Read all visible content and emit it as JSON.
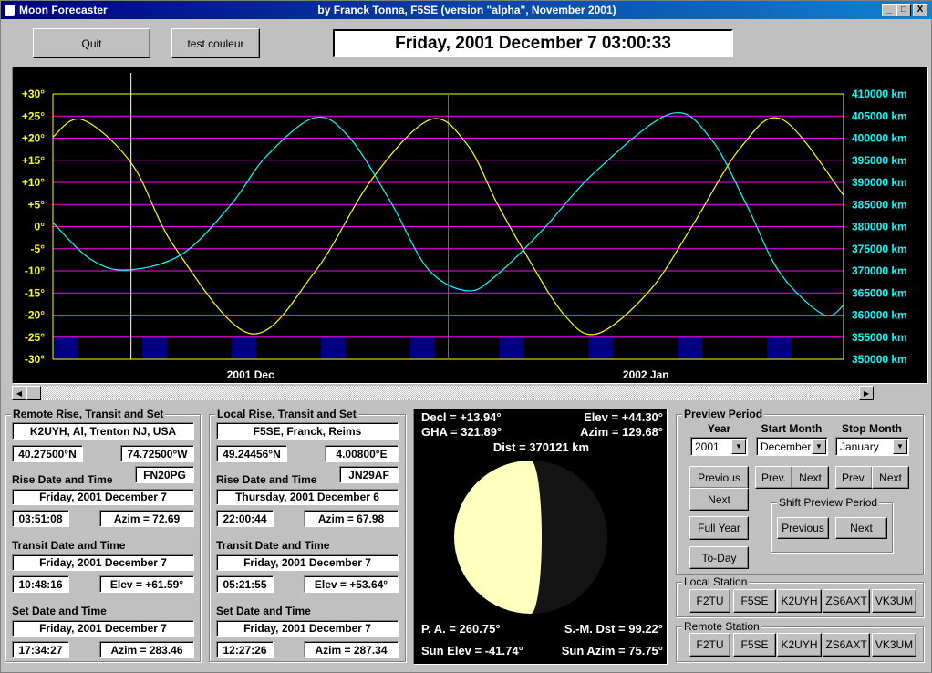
{
  "window": {
    "app_name": "Moon Forecaster",
    "title": "by Franck Tonna, F5SE (version \"alpha\", November 2001)",
    "minimize": "_",
    "maximize": "□",
    "close": "X"
  },
  "toolbar": {
    "quit_label": "Quit",
    "test_color_label": "test couleur"
  },
  "current_datetime": "Friday, 2001 December 7   03:00:33",
  "chart_data": {
    "type": "line",
    "xlim": [
      "2001-12-01T00:00",
      "2002-02-01T00:00"
    ],
    "x_month_labels": [
      {
        "label": "2001  Dec",
        "start": "2001-12-01T00:00",
        "end": "2002-01-01T00:00"
      },
      {
        "label": "2002  Jan",
        "start": "2002-01-01T00:00",
        "end": "2002-02-01T00:00"
      }
    ],
    "left_axis": {
      "ylim": [
        -30,
        30
      ],
      "ticks": [
        30,
        25,
        20,
        15,
        10,
        5,
        0,
        -5,
        -10,
        -15,
        -20,
        -25,
        -30
      ],
      "tick_labels": [
        "+30°",
        "+25°",
        "+20°",
        "+15°",
        "+10°",
        "+5°",
        "0°",
        "-5°",
        "-10°",
        "-15°",
        "-20°",
        "-25°",
        "-30°"
      ],
      "color": "#ffff00"
    },
    "right_axis": {
      "ylim": [
        350000,
        410000
      ],
      "ticks": [
        410000,
        405000,
        400000,
        395000,
        390000,
        385000,
        380000,
        375000,
        370000,
        365000,
        360000,
        355000,
        350000
      ],
      "tick_labels": [
        "410000 km",
        "405000 km",
        "400000 km",
        "395000 km",
        "390000 km",
        "385000 km",
        "380000 km",
        "375000 km",
        "370000 km",
        "365000 km",
        "360000 km",
        "355000 km",
        "350000 km"
      ],
      "color": "#00ffff"
    },
    "grid": true,
    "grid_color": "#ff00ff",
    "current_time": "2001-12-07T03:00:33",
    "current_time_color": "#ffffff",
    "weekend_band": {
      "color": "#000080",
      "from_deg": -30,
      "to_deg": -25,
      "days": 2,
      "starts": [
        "2001-12-01",
        "2001-12-08",
        "2001-12-15",
        "2001-12-22",
        "2001-12-29",
        "2002-01-05",
        "2002-01-12",
        "2002-01-19",
        "2002-01-26"
      ]
    },
    "series": [
      {
        "axis": "left",
        "color": "#ffff00",
        "points": [
          [
            "2001-12-01T00:00",
            20.3
          ],
          [
            "2001-12-03T07:00",
            24.2
          ],
          [
            "2001-12-07T05:00",
            14.1
          ],
          [
            "2001-12-10T14:00",
            -4.8
          ],
          [
            "2001-12-16T12:00",
            -24.2
          ],
          [
            "2001-12-21T12:00",
            -10.4
          ],
          [
            "2001-12-26T02:00",
            11.0
          ],
          [
            "2001-12-30T14:00",
            24.2
          ],
          [
            "2002-01-02T12:00",
            18.5
          ],
          [
            "2002-01-04T19:00",
            5.5
          ],
          [
            "2002-01-06T19:00",
            -4.8
          ],
          [
            "2002-01-10T02:00",
            -19.9
          ],
          [
            "2002-01-12T17:00",
            -24.2
          ],
          [
            "2002-01-16T19:00",
            -14.5
          ],
          [
            "2002-01-20T02:00",
            -0.1
          ],
          [
            "2002-01-23T22:00",
            17.8
          ],
          [
            "2002-01-27T05:00",
            24.2
          ],
          [
            "2002-02-01T00:00",
            7.1
          ]
        ]
      },
      {
        "axis": "right",
        "color": "#00ffff",
        "points": [
          [
            "2001-12-01T00:00",
            380900
          ],
          [
            "2001-12-03T22:00",
            372700
          ],
          [
            "2001-12-06T19:00",
            370200
          ],
          [
            "2001-12-11T02:00",
            373700
          ],
          [
            "2001-12-14T22:00",
            384800
          ],
          [
            "2001-12-17T17:00",
            395800
          ],
          [
            "2001-12-21T12:00",
            404600
          ],
          [
            "2001-12-24T05:00",
            400300
          ],
          [
            "2001-12-27T12:00",
            385500
          ],
          [
            "2001-12-30T10:00",
            370400
          ],
          [
            "2002-01-02T12:00",
            365500
          ],
          [
            "2002-01-04T19:00",
            369000
          ],
          [
            "2002-01-08T10:00",
            379300
          ],
          [
            "2002-01-12T12:00",
            392300
          ],
          [
            "2002-01-18T10:00",
            405500
          ],
          [
            "2002-01-21T14:00",
            399900
          ],
          [
            "2002-01-24T10:00",
            384800
          ],
          [
            "2002-01-27T00:00",
            369600
          ],
          [
            "2002-01-30T10:00",
            360100
          ],
          [
            "2002-02-01T00:00",
            362200
          ]
        ]
      }
    ]
  },
  "remote": {
    "group_title": "Remote Rise, Transit and Set",
    "station": "K2UYH, Al, Trenton NJ, USA",
    "lat": "40.27500°N",
    "lon": "74.72500°W",
    "locator": "FN20PG",
    "rise_label": "Rise Date and Time",
    "rise_date": "Friday, 2001 December 7",
    "rise_time": "03:51:08",
    "rise_azim": "Azim = 72.69",
    "transit_label": "Transit Date and Time",
    "transit_date": "Friday, 2001 December 7",
    "transit_time": "10:48:16",
    "transit_elev": "Elev = +61.59°",
    "set_label": "Set Date and Time",
    "set_date": "Friday, 2001 December 7",
    "set_time": "17:34:27",
    "set_azim": "Azim = 283.46"
  },
  "local": {
    "group_title": "Local Rise, Transit and Set",
    "station": "F5SE, Franck, Reims",
    "lat": "49.24456°N",
    "lon": "4.00800°E",
    "locator": "JN29AF",
    "rise_label": "Rise Date and Time",
    "rise_date": "Thursday, 2001 December 6",
    "rise_time": "22:00:44",
    "rise_azim": "Azim = 67.98",
    "transit_label": "Transit Date and Time",
    "transit_date": "Friday, 2001 December 7",
    "transit_time": "05:21:55",
    "transit_elev": "Elev = +53.64°",
    "set_label": "Set Date and Time",
    "set_date": "Friday, 2001 December 7",
    "set_time": "12:27:26",
    "set_azim": "Azim = 287.34"
  },
  "moon": {
    "decl": "Decl = +13.94°",
    "elev": "Elev = +44.30°",
    "gha": "GHA = 321.89°",
    "azim": "Azim = 129.68°",
    "dist": "Dist = 370121 km",
    "pa": "P. A. = 260.75°",
    "sm_dst": "S.-M. Dst = 99.22°",
    "sun_elev": "Sun Elev = -41.74°",
    "sun_azim": "Sun Azim = 75.75°",
    "lit_color": "#ffffc0",
    "dark_color": "#141414"
  },
  "preview": {
    "group_title": "Preview Period",
    "year_label": "Year",
    "start_month_label": "Start Month",
    "stop_month_label": "Stop Month",
    "year": "2001",
    "start_month": "December",
    "stop_month": "January",
    "previous": "Previous",
    "next": "Next",
    "prev_short": "Prev.",
    "full_year": "Full Year",
    "today": "To-Day",
    "shift_title": "Shift Preview Period"
  },
  "local_station": {
    "title": "Local Station",
    "buttons": [
      "F2TU",
      "F5SE",
      "K2UYH",
      "ZS6AXT",
      "VK3UM"
    ]
  },
  "remote_station": {
    "title": "Remote Station",
    "buttons": [
      "F2TU",
      "F5SE",
      "K2UYH",
      "ZS6AXT",
      "VK3UM"
    ]
  }
}
